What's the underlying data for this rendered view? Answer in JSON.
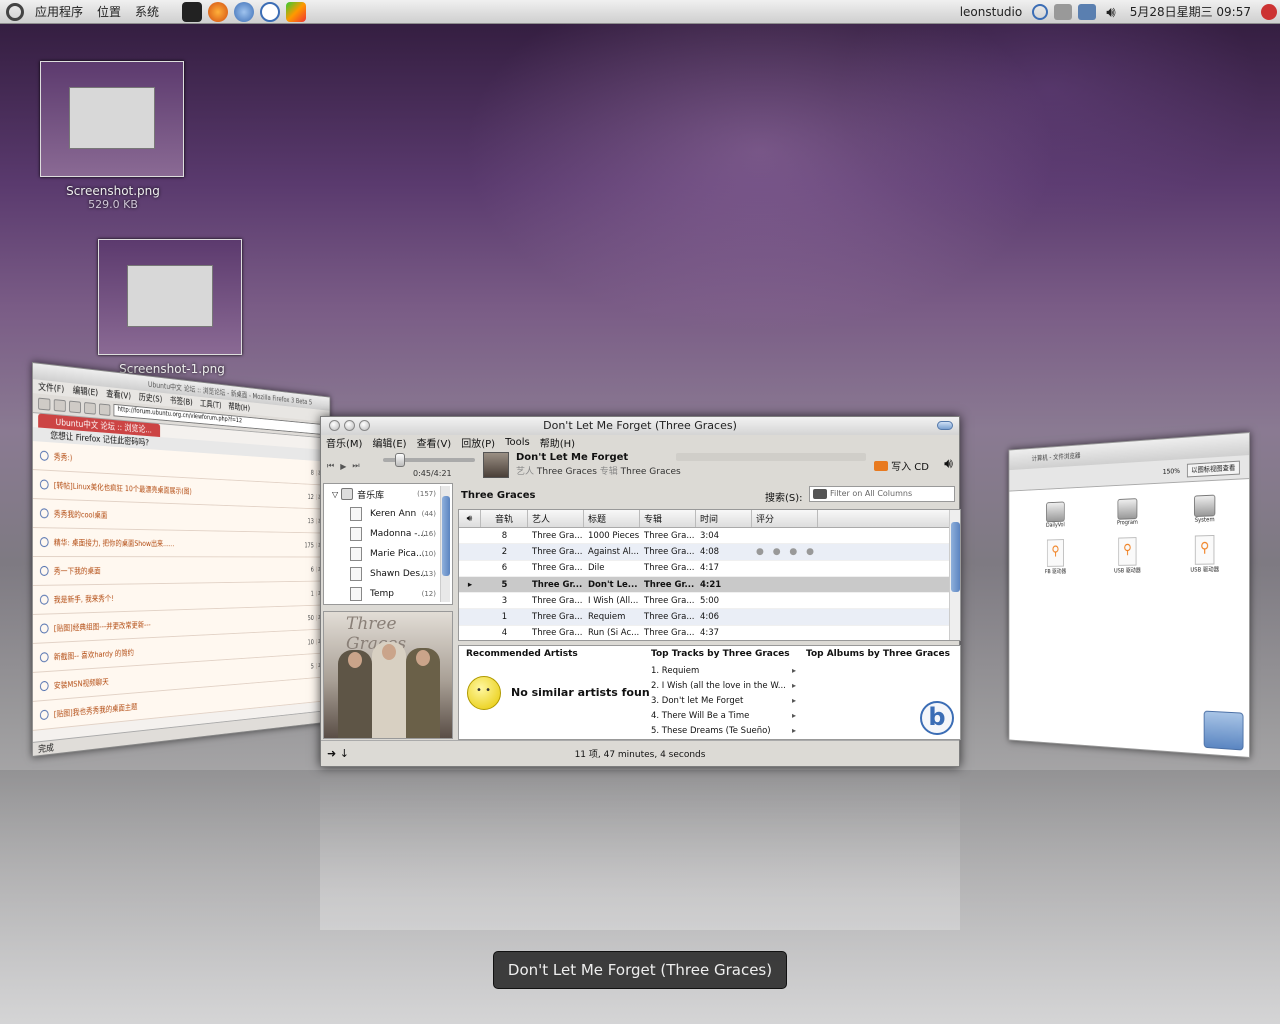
{
  "panel": {
    "menu_apps": "应用程序",
    "menu_places": "位置",
    "menu_system": "系统",
    "user": "leonstudio",
    "clock": "5月28日星期三 09:57"
  },
  "desktop": {
    "icons": [
      {
        "name": "Screenshot.png",
        "size": "529.0 KB"
      },
      {
        "name": "Screenshot-1.png"
      }
    ]
  },
  "firefox": {
    "title": "Ubuntu中文 论坛 :: 浏览论坛 - 新桌面 - Mozilla Firefox 3 Beta 5",
    "menu": [
      "文件(F)",
      "编辑(E)",
      "查看(V)",
      "历史(S)",
      "书签(B)",
      "工具(T)",
      "帮助(H)"
    ],
    "url": "http://forum.ubuntu.org.cn/viewforum.php?f=12",
    "tab": "Ubuntu中文 论坛 :: 浏览论...",
    "notice": "您想让 Firefox 记住此密码吗?",
    "topics": [
      {
        "title": "秀秀:)",
        "count": "8",
        "date": "2008"
      },
      {
        "title": "[转帖]Linux美化也疯狂 10个最漂亮桌面展示(图)",
        "count": "12",
        "date": "2008"
      },
      {
        "title": "秀秀我的cool桌面",
        "count": "13",
        "date": "2008"
      },
      {
        "title": "精华: 桌面接力, 把你的桌面Show出来......",
        "count": "175",
        "date": "2008"
      },
      {
        "title": "秀一下我的桌面",
        "count": "6",
        "date": "2008"
      },
      {
        "title": "我是新手, 我来秀个!",
        "count": "1",
        "date": "2008"
      },
      {
        "title": "[贴图]经典组图---并更改常更新---",
        "count": "50",
        "date": "2008"
      },
      {
        "title": "新截图-- 喜欢hardy 的简约",
        "count": "10",
        "date": "2008"
      },
      {
        "title": "安装MSN视频聊天",
        "count": "5",
        "date": "2008"
      },
      {
        "title": "[贴图]我也秀秀我的桌面主题",
        "count": "",
        "date": ""
      }
    ],
    "status": "完成"
  },
  "banshee": {
    "title": "Don't Let Me Forget (Three Graces)",
    "menu": [
      "音乐(M)",
      "编辑(E)",
      "查看(V)",
      "回放(P)",
      "Tools",
      "帮助(H)"
    ],
    "position": "0:45/4:21",
    "progress": 0.17,
    "now_playing": {
      "track": "Don't Let Me Forget",
      "artist_label": "艺人",
      "artist": "Three Graces",
      "album_label": "专辑",
      "album": "Three Graces"
    },
    "burn_label": "写入 CD",
    "sources": {
      "library": {
        "label": "音乐库",
        "count": "(157)"
      },
      "playlists": [
        {
          "label": "Keren Ann",
          "count": "(44)"
        },
        {
          "label": "Madonna -...",
          "count": "(16)"
        },
        {
          "label": "Marie Pica...",
          "count": "(10)"
        },
        {
          "label": "Shawn Des...",
          "count": "(13)"
        },
        {
          "label": "Temp",
          "count": "(12)"
        }
      ]
    },
    "album_art_text": "Three Graces",
    "list_title": "Three Graces",
    "search_label": "搜索(S):",
    "search_placeholder": "Filter on All Columns",
    "columns": [
      "音轨",
      "艺人",
      "标题",
      "专辑",
      "时间",
      "评分"
    ],
    "tracks": [
      {
        "num": "8",
        "artist": "Three Gra...",
        "title": "1000 Pieces",
        "album": "Three Gra...",
        "time": "3:04",
        "rating": ""
      },
      {
        "num": "2",
        "artist": "Three Gra...",
        "title": "Against Al...",
        "album": "Three Gra...",
        "time": "4:08",
        "rating": "● ● ● ● ●"
      },
      {
        "num": "6",
        "artist": "Three Gra...",
        "title": "Dile",
        "album": "Three Gra...",
        "time": "4:17",
        "rating": ""
      },
      {
        "num": "5",
        "artist": "Three Gr...",
        "title": "Don't Le...",
        "album": "Three Gr...",
        "time": "4:21",
        "rating": "",
        "playing": true
      },
      {
        "num": "3",
        "artist": "Three Gra...",
        "title": "I Wish (All...",
        "album": "Three Gra...",
        "time": "5:00",
        "rating": ""
      },
      {
        "num": "1",
        "artist": "Three Gra...",
        "title": "Requiem",
        "album": "Three Gra...",
        "time": "4:06",
        "rating": ""
      },
      {
        "num": "4",
        "artist": "Three Gra...",
        "title": "Run (Si Ac...",
        "album": "Three Gra...",
        "time": "4:37",
        "rating": ""
      }
    ],
    "recommended_title": "Recommended Artists",
    "no_similar": "No similar artists foun",
    "top_tracks_title": "Top Tracks by Three Graces",
    "top_tracks": [
      "1. Requiem",
      "2. I Wish (all the love in the W...",
      "3. Don't let Me Forget",
      "4. There Will Be a Time",
      "5. These Dreams (Te Sueño)"
    ],
    "top_albums_title": "Top Albums by Three Graces",
    "status": "11 项, 47 minutes, 4 seconds"
  },
  "nautilus": {
    "title": "计算机 - 文件浏览器",
    "zoom": "150%",
    "view_mode": "以图标视图查看",
    "items": [
      {
        "label": "DailyVol",
        "type": "hdd"
      },
      {
        "label": "Program",
        "type": "hdd"
      },
      {
        "label": "System",
        "type": "hdd"
      },
      {
        "label": "FB 驱动器",
        "type": "usb"
      },
      {
        "label": "USB 驱动器",
        "type": "usb"
      },
      {
        "label": "USB 驱动器",
        "type": "usb"
      }
    ]
  },
  "tooltip": "Don't Let Me Forget (Three Graces)"
}
